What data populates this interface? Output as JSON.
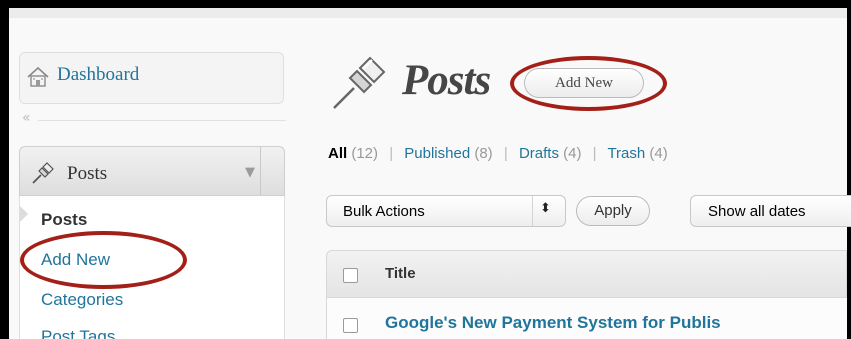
{
  "sidebar": {
    "dashboard_label": "Dashboard",
    "collapse_glyph": "«",
    "posts_header_label": "Posts",
    "posts_header_toggle_glyph": "▼",
    "submenu": {
      "posts": "Posts",
      "add_new": "Add New",
      "categories": "Categories",
      "post_tags": "Post Tags"
    }
  },
  "main": {
    "page_title": "Posts",
    "add_new_button": "Add New",
    "filters": {
      "all_label": "All",
      "all_count": "(12)",
      "published_label": "Published",
      "published_count": "(8)",
      "drafts_label": "Drafts",
      "drafts_count": "(4)",
      "trash_label": "Trash",
      "trash_count": "(4)",
      "separator": "|"
    },
    "bulk_actions": {
      "selected": "Bulk Actions",
      "arrows_glyph": "⬍"
    },
    "apply_button": "Apply",
    "dates_filter": {
      "selected": "Show all dates"
    },
    "table": {
      "columns": [
        "Title"
      ],
      "rows": [
        {
          "title": "Google's New Payment System for Publis"
        }
      ]
    }
  },
  "colors": {
    "link": "#21759b",
    "highlight_ellipse": "#a31f17",
    "heading_text": "#464646"
  },
  "icons": {
    "dashboard": "house-icon",
    "posts": "pushpin-icon",
    "collapse": "double-chevron-left-icon",
    "posts_toggle": "triangle-down-icon",
    "bulk_select": "updown-arrows-icon"
  }
}
